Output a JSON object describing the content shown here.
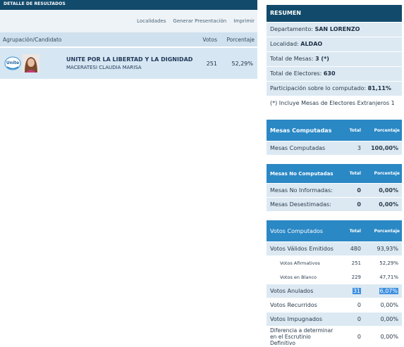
{
  "left": {
    "detail_title": "DETALLE DE RESULTADOS",
    "toolbar": [
      "Localidades",
      "Generar Presentación",
      "Imprimir"
    ],
    "columns": {
      "agrupacion": "Agrupación/Candidato",
      "votos": "Votos",
      "porcentaje": "Porcentaje"
    },
    "rows": [
      {
        "logo_text": "Unite",
        "party": "UNITE POR LA LIBERTAD Y LA DIGNIDAD",
        "candidate": "MACERATESI CLAUDIA MARISA",
        "votos": "251",
        "porcentaje": "52,29%"
      }
    ]
  },
  "resumen": {
    "title": "RESUMEN",
    "lines": [
      {
        "label": "Departamento: ",
        "value": "SAN LORENZO"
      },
      {
        "label": "Localidad: ",
        "value": "ALDAO"
      },
      {
        "label": "Total de Mesas: ",
        "value": "3 (*)"
      },
      {
        "label": "Total de Electores: ",
        "value": "630"
      },
      {
        "label": "Participación sobre lo computado: ",
        "value": "81,11%"
      }
    ],
    "note": "(*) Incluye Mesas de Electores Extranjeros 1"
  },
  "mesas_computadas": {
    "title": "Mesas Computadas",
    "h_total": "Total",
    "h_pct": "Porcentaje",
    "rows": [
      {
        "label": "Mesas Computadas",
        "total": "3",
        "pct": "100,00%"
      }
    ]
  },
  "mesas_no_computadas": {
    "title": "Mesas No Computadas",
    "h_total": "Total",
    "h_pct": "Porcentaje",
    "rows": [
      {
        "label": "Mesas No Informadas:",
        "total": "0",
        "pct": "0,00%"
      },
      {
        "label": "Mesas Desestimadas:",
        "total": "0",
        "pct": "0,00%"
      }
    ]
  },
  "votos_computados": {
    "title": "Votos Computados",
    "h_total": "Total",
    "h_pct": "Porcentaje",
    "rows": [
      {
        "label": "Votos Válidos Emitidos",
        "total": "480",
        "pct": "93,93%"
      },
      {
        "label": "Votos Afirmativos",
        "total": "251",
        "pct": "52,29%"
      },
      {
        "label": "Votos en Blanco",
        "total": "229",
        "pct": "47,71%"
      },
      {
        "label": "Votos Anulados",
        "total": "31",
        "pct": "6,07%"
      },
      {
        "label": "Votos Recurridos",
        "total": "0",
        "pct": "0,00%"
      },
      {
        "label": "Votos Impugnados",
        "total": "0",
        "pct": "0,00%"
      },
      {
        "label": "Diferencia a determinar en el Escrutinio Definitivo",
        "total": "0",
        "pct": "0,00%"
      }
    ]
  },
  "colors": {
    "dark_header": "#124a6b",
    "section_header": "#2a88c5",
    "row_alt": "#dce9f2",
    "selection": "#3d8fe0"
  }
}
